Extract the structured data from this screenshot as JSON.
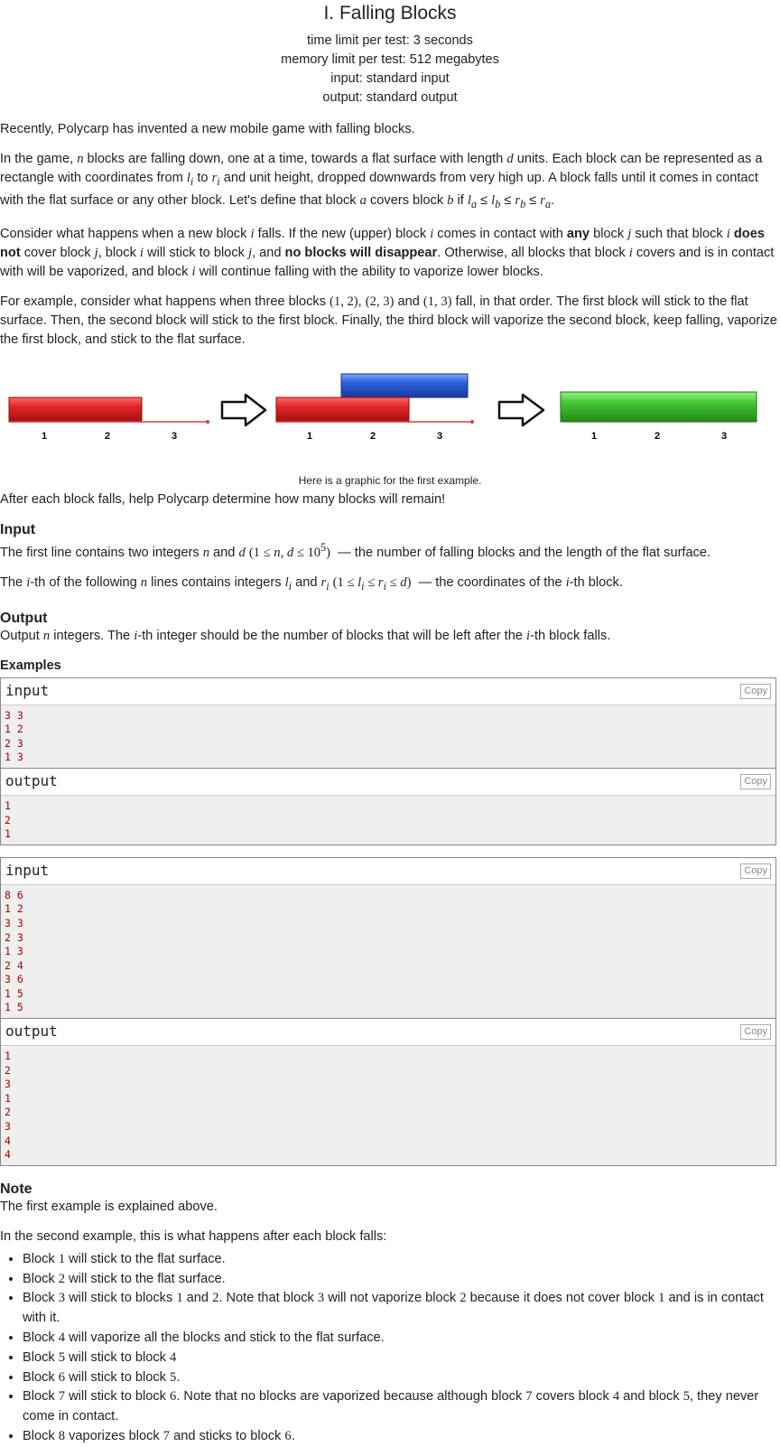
{
  "header": {
    "title": "I. Falling Blocks",
    "time_limit": "time limit per test: 3 seconds",
    "memory_limit": "memory limit per test: 512 megabytes",
    "input": "input: standard input",
    "output": "output: standard output"
  },
  "statement": {
    "intro": "Recently, Polycarp has invented a new mobile game with falling blocks.",
    "after_figure": "After each block falls, help Polycarp determine how many blocks will remain!"
  },
  "figure": {
    "caption": "Here is a graphic for the first example.",
    "ticks": [
      "1",
      "2",
      "3"
    ]
  },
  "input_section": {
    "title": "Input"
  },
  "output_section": {
    "title": "Output"
  },
  "examples": {
    "title": "Examples",
    "copy_label": "Copy",
    "input_label": "input",
    "output_label": "output",
    "tests": [
      {
        "input": [
          "3 3",
          "1 2",
          "2 3",
          "1 3"
        ],
        "output": [
          "1",
          "2",
          "1"
        ]
      },
      {
        "input": [
          "8 6",
          "1 2",
          "3 3",
          "2 3",
          "1 3",
          "2 4",
          "3 6",
          "1 5",
          "1 5"
        ],
        "output": [
          "1",
          "2",
          "3",
          "1",
          "2",
          "3",
          "4",
          "4"
        ]
      }
    ]
  },
  "note": {
    "title": "Note",
    "first": "The first example is explained above.",
    "second_intro": "In the second example, this is what happens after each block falls:"
  },
  "colors": {
    "red_block": "#d42020",
    "blue_block": "#2a5ed8",
    "green_block": "#3dbb2c",
    "io_text": "#aa0000"
  }
}
